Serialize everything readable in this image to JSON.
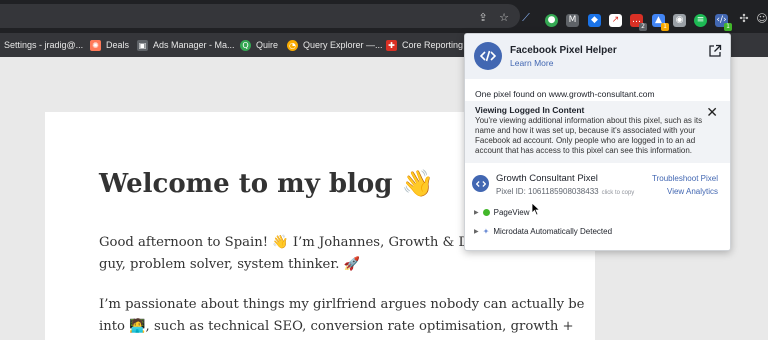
{
  "browser": {
    "bookmarks": [
      {
        "label": "Settings - jradig@...",
        "icon": "gear-icon",
        "color": "#8ab4f8"
      },
      {
        "label": "Deals",
        "icon": "hubspot-icon",
        "color": "#ff7a59"
      },
      {
        "label": "Ads Manager - Ma...",
        "icon": "ads-manager-icon",
        "color": "#5f6368"
      },
      {
        "label": "Quire",
        "icon": "quire-icon",
        "color": "#34a853"
      },
      {
        "label": "Query Explorer —...",
        "icon": "analytics-icon",
        "color": "#f9ab00"
      },
      {
        "label": "Core Reporting A",
        "icon": "core-reporting-icon",
        "color": "#d93025"
      }
    ],
    "extension_badges": {
      "red_ext": "2",
      "color_ext": "1",
      "pixel_helper": "1"
    }
  },
  "page": {
    "blog_title": "Welcome to my blog 👋",
    "paragraph_1_line_1": "Good afternoon to Spain! 👋 I’m Johannes, Growth & Digital M",
    "paragraph_1_line_2": "guy, problem solver, system thinker. 🚀",
    "paragraph_2_line_1": "I’m passionate about things my girlfriend argues nobody can actually be",
    "paragraph_2_line_2": "into 🧑‍💻, such as technical SEO, conversion rate optimisation, growth +"
  },
  "popup": {
    "title": "Facebook Pixel Helper",
    "learn_more": "Learn More",
    "pixel_found": "One pixel found on www.growth-consultant.com",
    "notice": {
      "title": "Viewing Logged In Content",
      "lines": [
        "You're viewing additional information about this pixel, such as its",
        "name and how it was set up, because it's associated with your",
        "Facebook ad account. Only people who are logged in to an ad",
        "account that has access to this pixel can see this information."
      ]
    },
    "pixel": {
      "name": "Growth Consultant Pixel",
      "id_text": "Pixel ID: 1061185908038433",
      "copy_hint": "click to copy",
      "troubleshoot": "Troubleshoot Pixel",
      "analytics": "View Analytics"
    },
    "events": [
      {
        "label": "PageView",
        "status": "success"
      },
      {
        "label": "Microdata Automatically Detected",
        "status": "info"
      }
    ]
  },
  "colors": {
    "facebook_blue": "#4267b2",
    "success_green": "#42b72a",
    "toolbar_dark": "#202124",
    "bookmarks_bar": "#35363a"
  }
}
